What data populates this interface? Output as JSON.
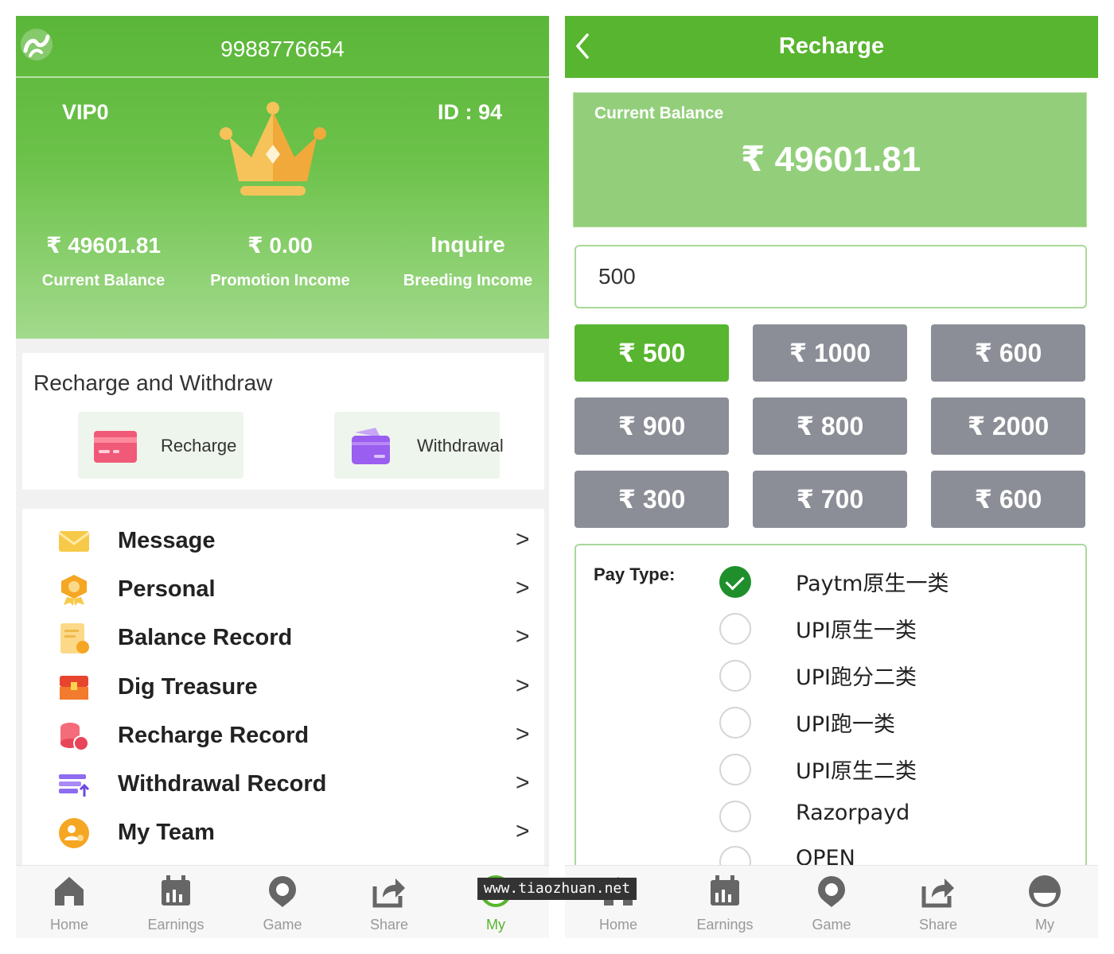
{
  "left": {
    "header": {
      "phone": "9988776654",
      "vip": "VIP0",
      "user_id": "ID : 94"
    },
    "stats": [
      {
        "value": "₹ 49601.81",
        "label": "Current Balance"
      },
      {
        "value": "₹ 0.00",
        "label": "Promotion Income"
      },
      {
        "value": "Inquire",
        "label": "Breeding Income"
      }
    ],
    "rw": {
      "title": "Recharge and Withdraw",
      "recharge": "Recharge",
      "withdrawal": "Withdrawal"
    },
    "menu": [
      {
        "label": "Message",
        "icon": "envelope-icon",
        "arrow": ">"
      },
      {
        "label": "Personal",
        "icon": "badge-icon",
        "arrow": ">"
      },
      {
        "label": "Balance Record",
        "icon": "notepad-icon",
        "arrow": ">"
      },
      {
        "label": "Dig Treasure",
        "icon": "treasure-chest-icon",
        "arrow": ">"
      },
      {
        "label": "Recharge Record",
        "icon": "coins-icon",
        "arrow": ">"
      },
      {
        "label": "Withdrawal Record",
        "icon": "stack-icon",
        "arrow": ">"
      },
      {
        "label": "My Team",
        "icon": "team-icon",
        "arrow": ">"
      }
    ],
    "tabs": [
      {
        "label": "Home",
        "icon": "home-icon"
      },
      {
        "label": "Earnings",
        "icon": "calendar-icon"
      },
      {
        "label": "Game",
        "icon": "location-icon"
      },
      {
        "label": "Share",
        "icon": "share-icon"
      },
      {
        "label": "My",
        "icon": "user-icon",
        "active": true
      }
    ]
  },
  "right": {
    "header": {
      "title": "Recharge"
    },
    "balance": {
      "label": "Current Balance",
      "value": "₹ 49601.81"
    },
    "amount_input": {
      "value": "500"
    },
    "amounts": [
      {
        "label": "₹ 500",
        "selected": true
      },
      {
        "label": "₹ 1000"
      },
      {
        "label": "₹ 600"
      },
      {
        "label": "₹ 900"
      },
      {
        "label": "₹ 800"
      },
      {
        "label": "₹ 2000"
      },
      {
        "label": "₹ 300"
      },
      {
        "label": "₹ 700"
      },
      {
        "label": "₹ 600"
      }
    ],
    "pay": {
      "label": "Pay Type:",
      "options": [
        {
          "name": "Paytm原生一类",
          "checked": true
        },
        {
          "name": "UPI原生一类"
        },
        {
          "name": "UPI跑分二类"
        },
        {
          "name": "UPI跑一类"
        },
        {
          "name": "UPI原生二类"
        },
        {
          "name": "Razorpayd"
        },
        {
          "name": "OPEN"
        }
      ]
    },
    "tabs": [
      {
        "label": "Home",
        "icon": "home-icon"
      },
      {
        "label": "Earnings",
        "icon": "calendar-icon"
      },
      {
        "label": "Game",
        "icon": "location-icon"
      },
      {
        "label": "Share",
        "icon": "share-icon"
      },
      {
        "label": "My",
        "icon": "user-icon"
      }
    ]
  },
  "watermark": "www.tiaozhuan.net",
  "colors": {
    "brand_green": "#58b52f",
    "amount_gray": "#8b8e96",
    "tab_inactive": "#999999"
  }
}
